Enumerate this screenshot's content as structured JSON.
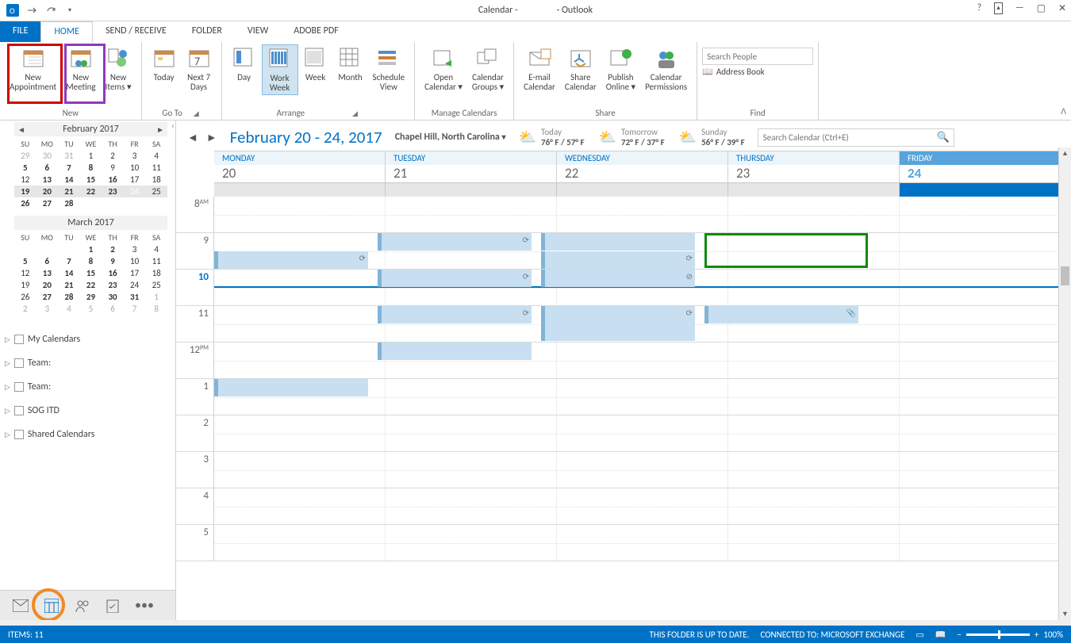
{
  "title": {
    "left": "Calendar -",
    "app": "- Outlook"
  },
  "tabs": [
    "FILE",
    "HOME",
    "SEND / RECEIVE",
    "FOLDER",
    "VIEW",
    "ADOBE PDF"
  ],
  "ribbon": {
    "new": {
      "appointment": "New\nAppointment",
      "meeting": "New\nMeeting",
      "items": "New\nItems ▾",
      "label": "New"
    },
    "goto": {
      "today": "Today",
      "next7": "Next 7\nDays",
      "label": "Go To"
    },
    "arrange": {
      "day": "Day",
      "workweek": "Work\nWeek",
      "week": "Week",
      "month": "Month",
      "schedule": "Schedule\nView",
      "label": "Arrange"
    },
    "manage": {
      "open": "Open\nCalendar ▾",
      "groups": "Calendar\nGroups ▾",
      "label": "Manage Calendars"
    },
    "share": {
      "email": "E-mail\nCalendar",
      "share": "Share\nCalendar",
      "publish": "Publish\nOnline ▾",
      "perm": "Calendar\nPermissions",
      "label": "Share"
    },
    "find": {
      "search_ph": "Search People",
      "ab": "Address Book",
      "label": "Find"
    }
  },
  "miniCals": [
    {
      "title": "February 2017",
      "dow": [
        "SU",
        "MO",
        "TU",
        "WE",
        "TH",
        "FR",
        "SA"
      ],
      "wk_bold_start": 20,
      "wk_bold_end": 24,
      "today": 24,
      "rows": [
        [
          {
            "n": 29,
            "m": 1
          },
          {
            "n": 30,
            "m": 1
          },
          {
            "n": 31,
            "m": 1
          },
          {
            "n": 1
          },
          {
            "n": 2
          },
          {
            "n": 3
          },
          {
            "n": 4
          }
        ],
        [
          {
            "n": 5,
            "b": 1
          },
          {
            "n": 6,
            "b": 1
          },
          {
            "n": 7,
            "b": 1
          },
          {
            "n": 8,
            "b": 1
          },
          {
            "n": 9
          },
          {
            "n": 10
          },
          {
            "n": 11
          }
        ],
        [
          {
            "n": 12
          },
          {
            "n": 13,
            "b": 1
          },
          {
            "n": 14,
            "b": 1
          },
          {
            "n": 15,
            "b": 1
          },
          {
            "n": 16,
            "b": 1
          },
          {
            "n": 17
          },
          {
            "n": 18
          }
        ],
        [
          {
            "n": 19,
            "b": 1,
            "w": 1
          },
          {
            "n": 20,
            "b": 1,
            "w": 1
          },
          {
            "n": 21,
            "b": 1,
            "w": 1
          },
          {
            "n": 22,
            "b": 1,
            "w": 1
          },
          {
            "n": 23,
            "b": 1,
            "w": 1
          },
          {
            "n": 24,
            "t": 1,
            "w": 1
          },
          {
            "n": 25,
            "w": 1
          }
        ],
        [
          {
            "n": 26,
            "b": 1
          },
          {
            "n": 27,
            "b": 1
          },
          {
            "n": 28,
            "b": 1
          },
          {
            "n": ""
          },
          {
            "n": ""
          },
          {
            "n": ""
          },
          {
            "n": ""
          }
        ]
      ]
    },
    {
      "title": "March 2017",
      "dow": [
        "SU",
        "MO",
        "TU",
        "WE",
        "TH",
        "FR",
        "SA"
      ],
      "rows": [
        [
          {
            "n": ""
          },
          {
            "n": ""
          },
          {
            "n": ""
          },
          {
            "n": 1,
            "b": 1
          },
          {
            "n": 2,
            "b": 1
          },
          {
            "n": 3
          },
          {
            "n": 4
          }
        ],
        [
          {
            "n": 5,
            "b": 1
          },
          {
            "n": 6,
            "b": 1
          },
          {
            "n": 7,
            "b": 1
          },
          {
            "n": 8,
            "b": 1
          },
          {
            "n": 9,
            "b": 1
          },
          {
            "n": 10
          },
          {
            "n": 11
          }
        ],
        [
          {
            "n": 12
          },
          {
            "n": 13,
            "b": 1
          },
          {
            "n": 14,
            "b": 1
          },
          {
            "n": 15,
            "b": 1
          },
          {
            "n": 16,
            "b": 1
          },
          {
            "n": 17
          },
          {
            "n": 18
          }
        ],
        [
          {
            "n": 19
          },
          {
            "n": 20,
            "b": 1
          },
          {
            "n": 21,
            "b": 1
          },
          {
            "n": 22,
            "b": 1
          },
          {
            "n": 23,
            "b": 1
          },
          {
            "n": 24
          },
          {
            "n": 25
          }
        ],
        [
          {
            "n": 26
          },
          {
            "n": 27,
            "b": 1
          },
          {
            "n": 28,
            "b": 1
          },
          {
            "n": 29,
            "b": 1
          },
          {
            "n": 30,
            "b": 1
          },
          {
            "n": 31,
            "b": 1
          },
          {
            "n": 1,
            "m": 1
          }
        ],
        [
          {
            "n": 2,
            "m": 1
          },
          {
            "n": 3,
            "m": 1
          },
          {
            "n": 4,
            "m": 1
          },
          {
            "n": 5,
            "m": 1
          },
          {
            "n": 6,
            "m": 1
          },
          {
            "n": 7,
            "m": 1
          },
          {
            "n": 8,
            "m": 1
          }
        ]
      ]
    }
  ],
  "calFolders": [
    "My Calendars",
    "Team:",
    "Team:",
    "SOG ITD",
    "Shared Calendars"
  ],
  "range": "February 20 - 24, 2017",
  "location": "Chapel Hill, North Carolina",
  "weather": [
    {
      "lbl": "Today",
      "temp": "76° F / 57° F"
    },
    {
      "lbl": "Tomorrow",
      "temp": "72° F / 37° F"
    },
    {
      "lbl": "Sunday",
      "temp": "56° F / 39° F"
    }
  ],
  "search_cal_ph": "Search Calendar (Ctrl+E)",
  "days": [
    {
      "name": "MONDAY",
      "num": "20"
    },
    {
      "name": "TUESDAY",
      "num": "21"
    },
    {
      "name": "WEDNESDAY",
      "num": "22"
    },
    {
      "name": "THURSDAY",
      "num": "23"
    },
    {
      "name": "FRIDAY",
      "num": "24",
      "fri": 1
    }
  ],
  "times": [
    "8",
    "9",
    "10",
    "11",
    "12",
    "1",
    "2",
    "3",
    "4",
    "5"
  ],
  "ampm": {
    "8": "AM",
    "12": "PM"
  },
  "status": {
    "items": "ITEMS: 11",
    "folder": "THIS FOLDER IS UP TO DATE.",
    "conn": "CONNECTED TO: MICROSOFT EXCHANGE",
    "zoom": "100%"
  }
}
